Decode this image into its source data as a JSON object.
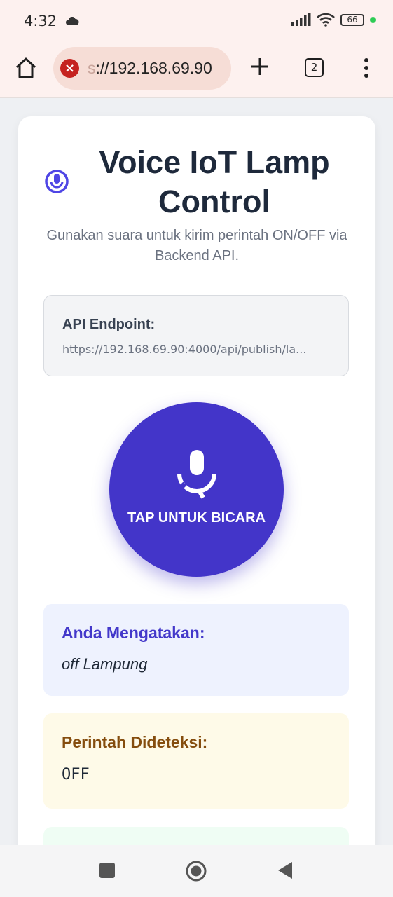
{
  "status_bar": {
    "time": "4:32",
    "battery": "66",
    "icons": [
      "cloud-icon",
      "signal-icon",
      "wifi-icon",
      "battery-icon",
      "green-dot-icon"
    ]
  },
  "browser": {
    "url_prefix": "s",
    "url": "://192.168.69.90",
    "tab_count": "2",
    "warning_color": "#c5221f"
  },
  "page": {
    "title": "Voice IoT Lamp Control",
    "subtitle": "Gunakan suara untuk kirim perintah ON/OFF via Backend API.",
    "api": {
      "label": "API Endpoint:",
      "url": "https://192.168.69.90:4000/api/publish/la..."
    },
    "mic_button": {
      "label": "TAP UNTUK BICARA",
      "color": "#4335c9"
    },
    "said": {
      "label": "Anda Mengatakan:",
      "text": "off Lampung"
    },
    "command": {
      "label": "Perintah Dideteksi:",
      "text": "OFF"
    }
  },
  "colors": {
    "accent": "#4335c9",
    "title": "#1e293b",
    "said_bg": "#eef2fe",
    "command_bg": "#fefae8",
    "result_bg": "#effdf4"
  }
}
